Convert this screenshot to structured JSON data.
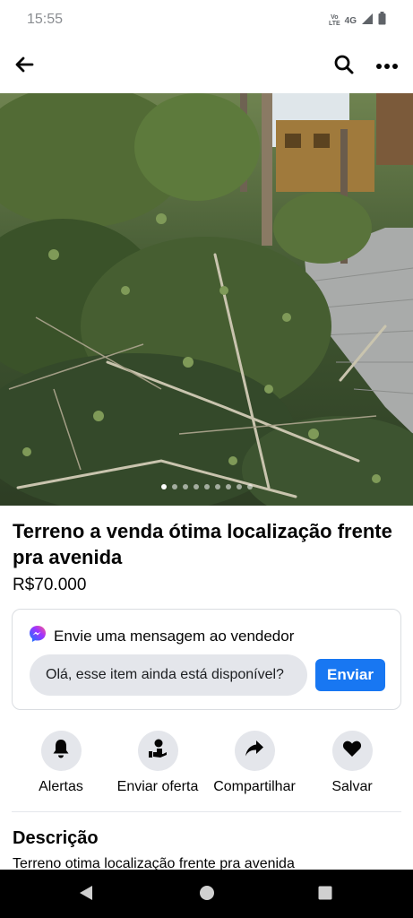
{
  "status_bar": {
    "time": "15:55",
    "volte_top": "Vo",
    "volte_bottom": "LTE",
    "network": "4G",
    "icons": [
      "signal-icon",
      "battery-icon"
    ]
  },
  "top_bar": {
    "icons": [
      "back-arrow-icon",
      "search-icon",
      "more-icon"
    ]
  },
  "photo": {
    "total_images": 9,
    "active_index": 0
  },
  "listing": {
    "title": " Terreno a venda ótima localização frente pra avenida",
    "price": "R$70.000"
  },
  "message_card": {
    "heading": "Envie uma mensagem ao vendedor",
    "input_value": "Olá, esse item ainda está disponível?",
    "send_label": "Enviar",
    "accent": "#1877f2"
  },
  "actions": [
    {
      "label": "Alertas",
      "icon": "bell-icon"
    },
    {
      "label": "Enviar oferta",
      "icon": "offer-icon"
    },
    {
      "label": "Compartilhar",
      "icon": "share-icon"
    },
    {
      "label": "Salvar",
      "icon": "heart-icon"
    }
  ],
  "description": {
    "heading": "Descrição",
    "text": "Terreno otima localização frente pra avenida"
  },
  "nav_bar": {
    "icons": [
      "nav-back-icon",
      "nav-home-icon",
      "nav-recent-icon"
    ]
  }
}
